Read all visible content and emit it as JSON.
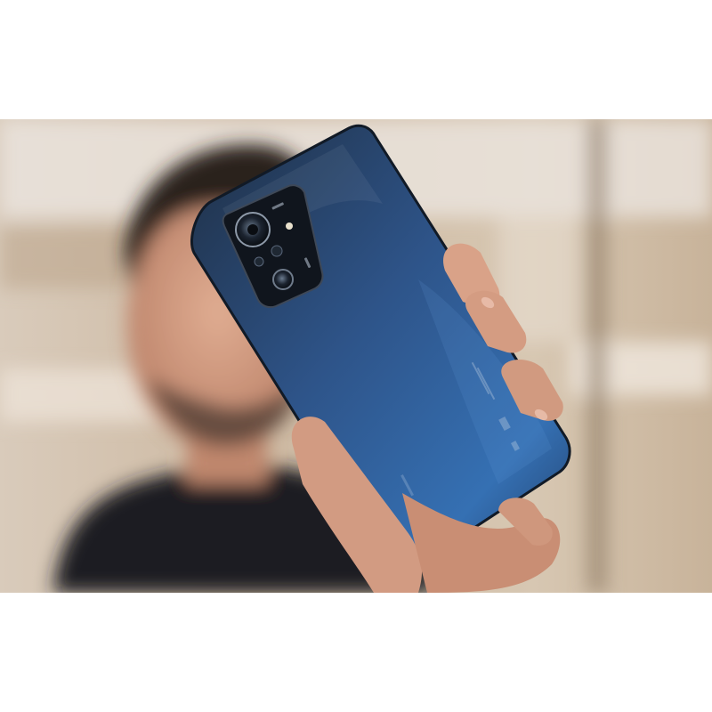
{
  "image": {
    "alt": "",
    "colors": {
      "page_background": "#ffffff",
      "backdrop_warm": "#c9b49b",
      "backdrop_light": "#e9e2da",
      "phone_blue": "#2f5f9c",
      "phone_dark": "#1b2a3e",
      "camera_module": "#10151d",
      "skin": "#d49a80",
      "shirt": "#1a1d22",
      "hair": "#2b241f"
    },
    "icons": [
      "camera-lens-icon",
      "flash-icon"
    ]
  }
}
